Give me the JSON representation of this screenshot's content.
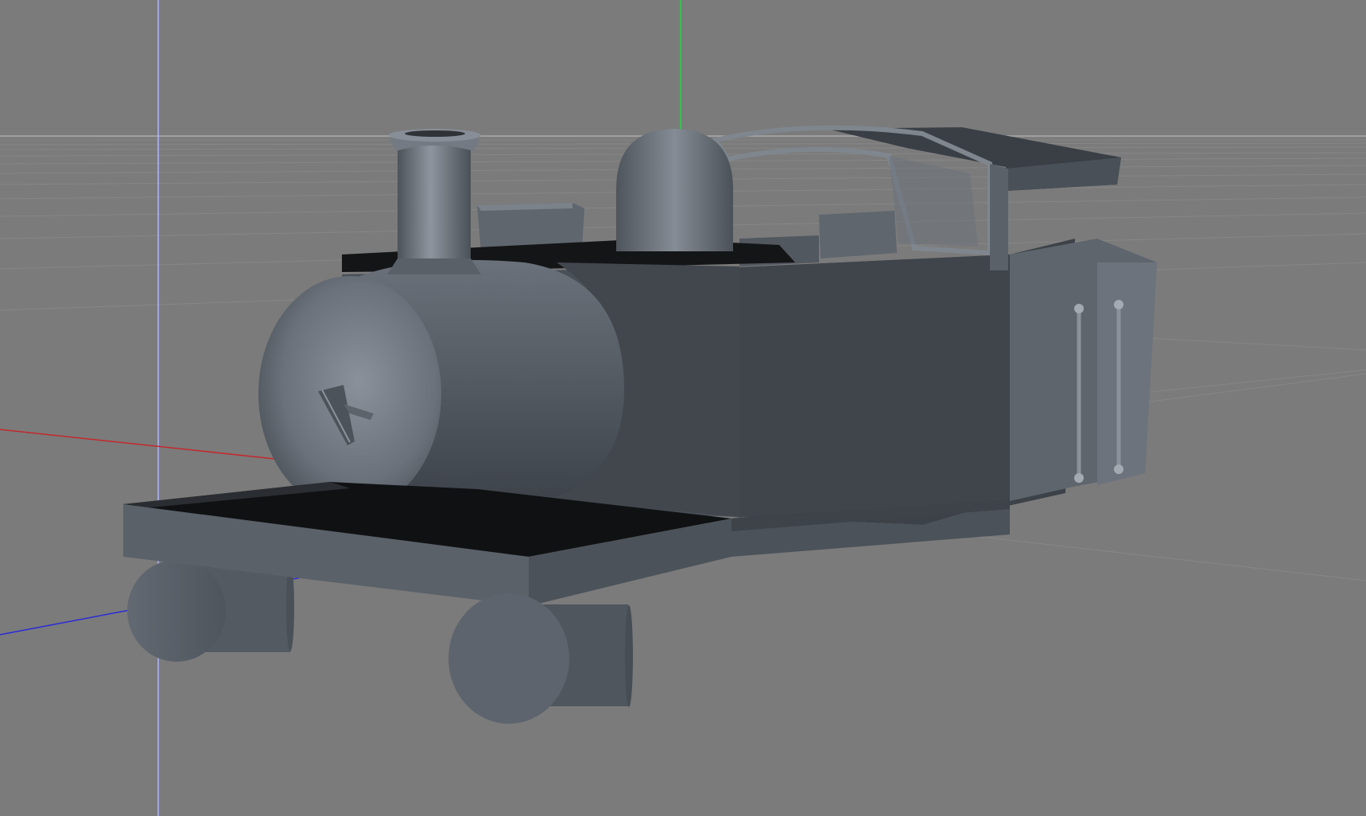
{
  "viewport": {
    "background_color": "#7b7b7b",
    "grid_color": "#8a8a8a",
    "axis_x_color": "#c0282c",
    "axis_y_color": "#28c040",
    "axis_z_color": "#2a2ad0",
    "axis_vertical_guide_color": "#b8b8ff"
  },
  "model": {
    "name": "steam-tank-locomotive",
    "base_color": "#5c636c",
    "shade_color": "#3e434a",
    "dark_color": "#111214",
    "highlight_color": "#8c949e"
  }
}
